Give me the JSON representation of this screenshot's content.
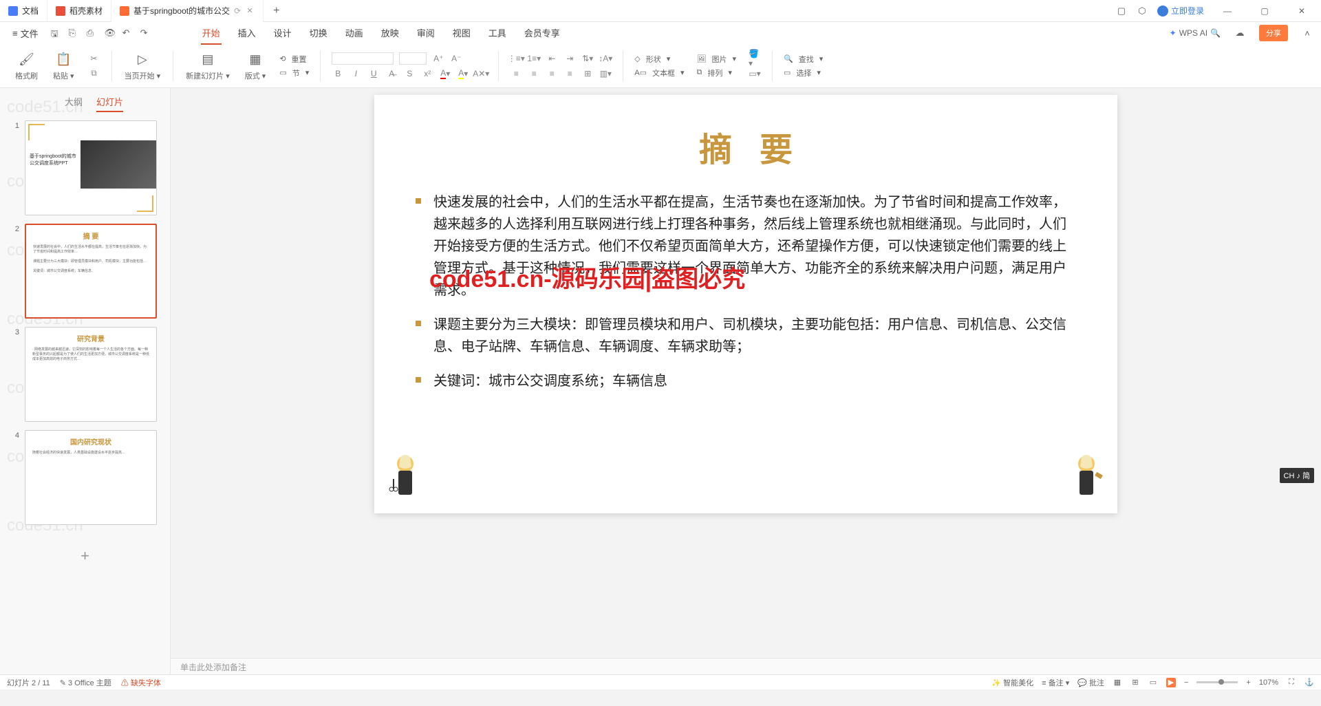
{
  "tabs": [
    {
      "label": "文档",
      "icon": "blue"
    },
    {
      "label": "稻壳素材",
      "icon": "red"
    },
    {
      "label": "基于springboot的城市公交",
      "icon": "orange",
      "active": true,
      "closable": true
    }
  ],
  "login_label": "立即登录",
  "file_menu": "文件",
  "menu_tabs": [
    "开始",
    "插入",
    "设计",
    "切换",
    "动画",
    "放映",
    "审阅",
    "视图",
    "工具",
    "会员专享"
  ],
  "menu_active": "开始",
  "wps_ai": "WPS AI",
  "share": "分享",
  "ribbon": {
    "format_painter": "格式刷",
    "paste": "粘贴",
    "from_current": "当页开始",
    "new_slide": "新建幻灯片",
    "layout": "版式",
    "reset": "重置",
    "section": "节",
    "shape": "形状",
    "picture": "图片",
    "textbox": "文本框",
    "arrange": "排列",
    "find": "查找",
    "select": "选择"
  },
  "side_tabs": {
    "outline": "大纲",
    "slides": "幻灯片"
  },
  "thumbs": [
    {
      "title": "基于springboot的城市公交调度系统PPT"
    },
    {
      "title": "摘 要"
    },
    {
      "title": "研究背景"
    },
    {
      "title": "国内研究现状"
    }
  ],
  "slide": {
    "title": "摘要",
    "bullets": [
      "快速发展的社会中，人们的生活水平都在提高，生活节奏也在逐渐加快。为了节省时间和提高工作效率，越来越多的人选择利用互联网进行线上打理各种事务，然后线上管理系统也就相继涌现。与此同时，人们开始接受方便的生活方式。他们不仅希望页面简单大方，还希望操作方便，可以快速锁定他们需要的线上管理方式。基于这种情况，我们需要这样一个界面简单大方、功能齐全的系统来解决用户问题，满足用户需求。",
      "课题主要分为三大模块：即管理员模块和用户、司机模块，主要功能包括：用户信息、司机信息、公交信息、电子站牌、车辆信息、车辆调度、车辆求助等；",
      "关键词：城市公交调度系统；车辆信息"
    ],
    "watermark_red": "code51.cn-源码乐园|盗图必究"
  },
  "notes_placeholder": "单击此处添加备注",
  "status": {
    "slide_pos": "幻灯片 2 / 11",
    "theme": "3 Office 主题",
    "missing_font": "缺失字体",
    "beautify": "智能美化",
    "notes": "备注",
    "comments": "批注",
    "zoom": "107%"
  },
  "ime": "CH ♪ 简",
  "wm_text": "code51.cn"
}
